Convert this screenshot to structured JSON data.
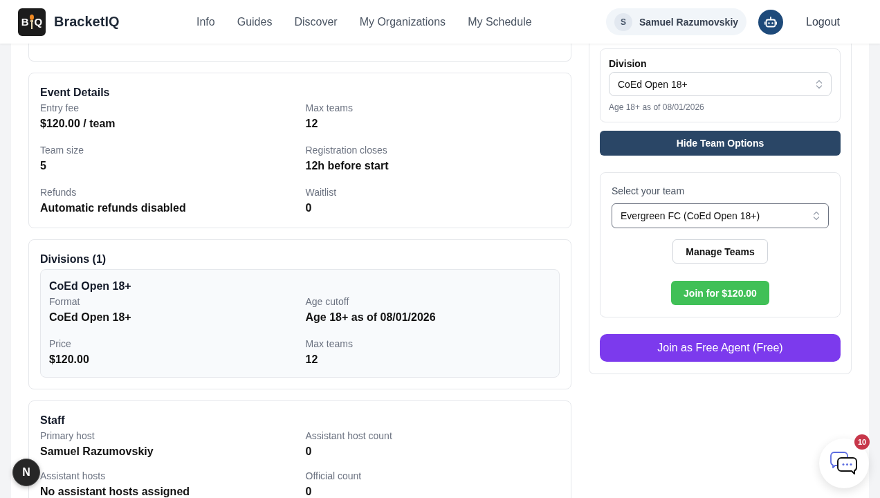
{
  "header": {
    "logo_letters": [
      "B",
      "Q"
    ],
    "brand": "BracketIQ",
    "nav": [
      "Info",
      "Guides",
      "Discover",
      "My Organizations",
      "My Schedule"
    ],
    "user": {
      "initial": "S",
      "name": "Samuel Razumovskiy"
    },
    "logout": "Logout"
  },
  "event_details": {
    "title": "Event Details",
    "fields": [
      {
        "label": "Entry fee",
        "value": "$120.00 / team"
      },
      {
        "label": "Max teams",
        "value": "12"
      },
      {
        "label": "Team size",
        "value": "5"
      },
      {
        "label": "Registration closes",
        "value": "12h before start"
      },
      {
        "label": "Refunds",
        "value": "Automatic refunds disabled"
      },
      {
        "label": "Waitlist",
        "value": "0"
      }
    ]
  },
  "divisions": {
    "title": "Divisions (1)",
    "items": [
      {
        "name": "CoEd Open 18+",
        "fields": [
          {
            "label": "Format",
            "value": "CoEd Open 18+"
          },
          {
            "label": "Age cutoff",
            "value": "Age 18+ as of 08/01/2026"
          },
          {
            "label": "Price",
            "value": "$120.00"
          },
          {
            "label": "Max teams",
            "value": "12"
          }
        ]
      }
    ]
  },
  "staff": {
    "title": "Staff",
    "fields": [
      {
        "label": "Primary host",
        "value": "Samuel Razumovskiy"
      },
      {
        "label": "Assistant host count",
        "value": "0"
      },
      {
        "label": "Assistant hosts",
        "value": "No assistant hosts assigned"
      },
      {
        "label": "Official count",
        "value": "0"
      }
    ]
  },
  "registration": {
    "division": {
      "label": "Division",
      "value": "CoEd Open 18+",
      "focused": false,
      "hint": "Age 18+ as of 08/01/2026"
    },
    "toggle_button": "Hide Team Options",
    "team": {
      "label": "Select your team",
      "value": "Evergreen FC (CoEd Open 18+)",
      "focused": true
    },
    "manage_button": "Manage Teams",
    "join_button": "Join for $120.00",
    "free_agent_button": "Join as Free Agent (Free)"
  },
  "dev_indicator": {
    "letter": "N"
  },
  "chat": {
    "badge": "10"
  }
}
